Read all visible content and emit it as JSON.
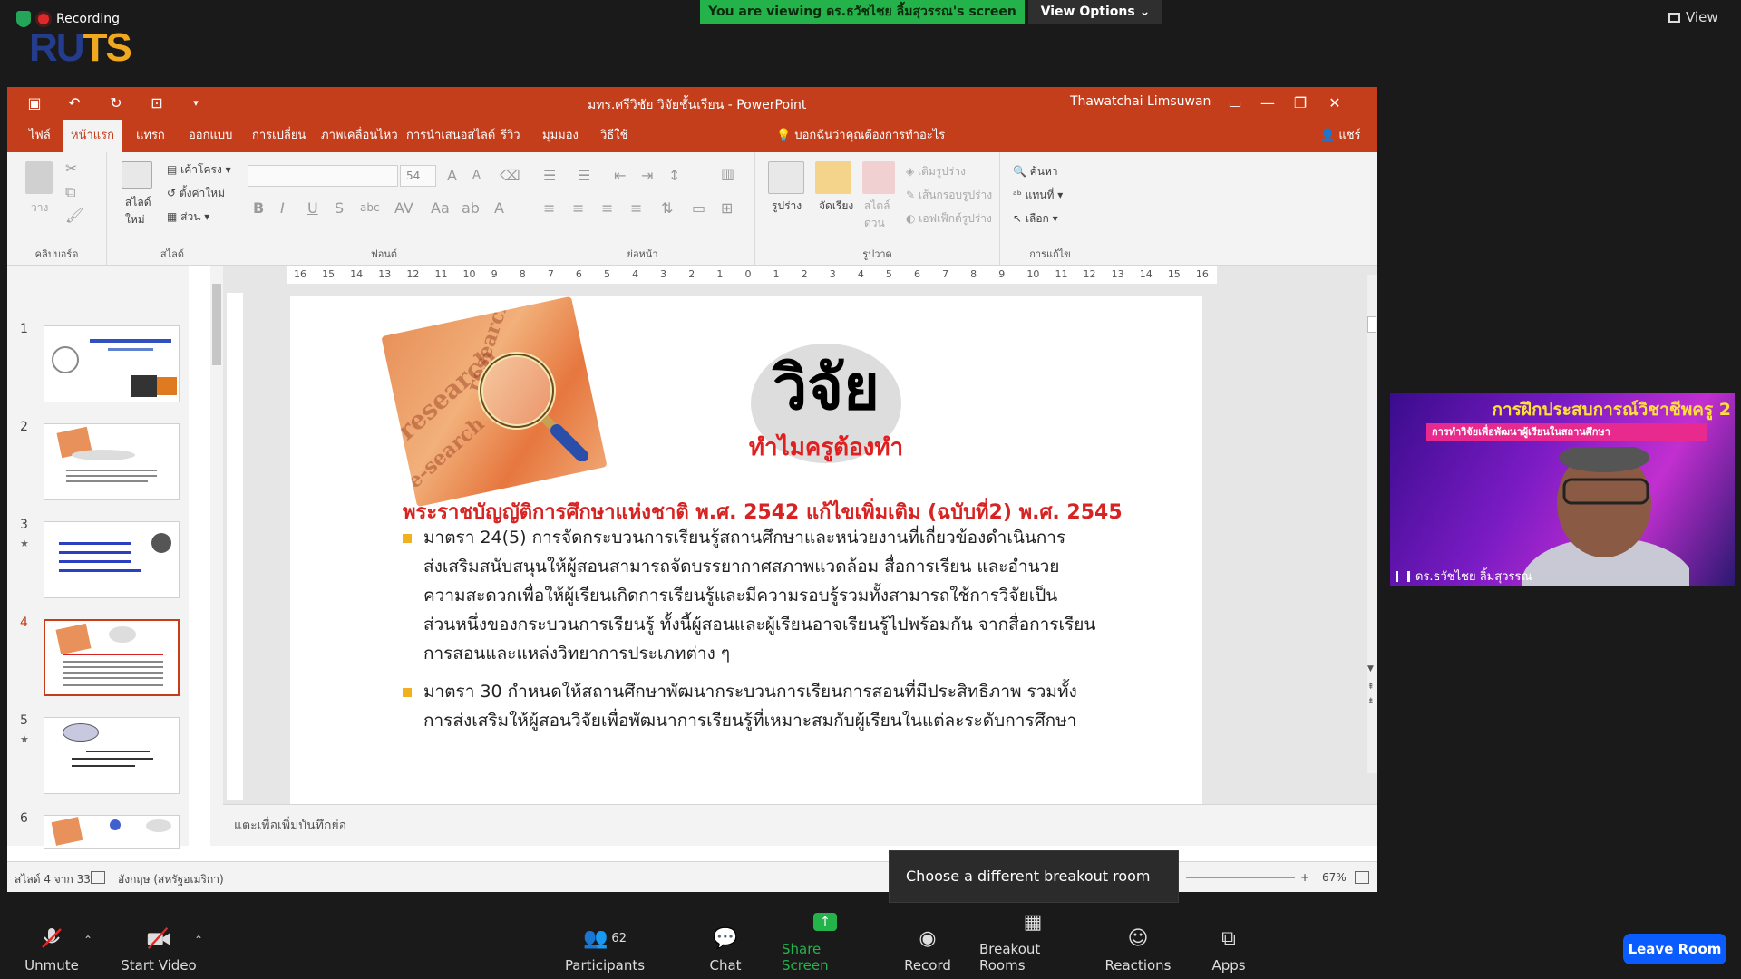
{
  "zoom": {
    "recording_label": "Recording",
    "viewing_banner": "You are viewing ดร.ธวัชไชย ลิ้มสุวรรณ's screen",
    "view_options": "View Options",
    "view_label": "View",
    "logo_text": "RUTS",
    "tooltip": "Choose a different breakout room",
    "toolbar": {
      "unmute": "Unmute",
      "start_video": "Start Video",
      "participants": "Participants",
      "participants_count": "62",
      "chat": "Chat",
      "share_screen": "Share Screen",
      "record": "Record",
      "breakout_rooms": "Breakout Rooms",
      "reactions": "Reactions",
      "apps": "Apps",
      "leave": "Leave Room"
    },
    "accent_green": "#24b24a",
    "leave_color": "#0b5cff"
  },
  "ppt": {
    "doc_title": "มทร.ศรีวิชัย วิจัยชั้นเรียน  -  PowerPoint",
    "user_name": "Thawatchai Limsuwan",
    "tabs": [
      "ไฟล์",
      "หน้าแรก",
      "แทรก",
      "ออกแบบ",
      "การเปลี่ยน",
      "ภาพเคลื่อนไหว",
      "การนำเสนอสไลด์",
      "รีวิว",
      "มุมมอง",
      "วิธีใช้"
    ],
    "tell_me": "บอกฉันว่าคุณต้องการทำอะไร",
    "share": "แชร์",
    "ribbon": {
      "clipboard": "คลิปบอร์ด",
      "paste": "วาง",
      "slides": "สไลด์",
      "new_slide": "สไลด์ใหม่",
      "layout": "เค้าโครง",
      "reset": "ตั้งค่าใหม่",
      "section": "ส่วน",
      "font": "ฟอนต์",
      "font_size": "54",
      "paragraph": "ย่อหน้า",
      "drawing": "รูปวาด",
      "shapes": "รูปร่าง",
      "arrange": "จัดเรียง",
      "quick_styles": "สไตล์ด่วน",
      "shape_fill": "เติมรูปร่าง",
      "shape_outline": "เส้นกรอบรูปร่าง",
      "shape_effects": "เอฟเฟ็กต์รูปร่าง",
      "editing": "การแก้ไข",
      "find": "ค้นหา",
      "replace": "แทนที่",
      "select": "เลือก"
    },
    "accent": "#c43e1c",
    "slide_numbers": [
      "1",
      "2",
      "3",
      "4",
      "5",
      "6"
    ],
    "notes_placeholder": "แตะเพื่อเพิ่มบันทึกย่อ",
    "status": {
      "slide_of": "สไลด์ 4 จาก 33",
      "language": "อังกฤษ (สหรัฐอเมริกา)",
      "zoom": "67%"
    },
    "ruler_ticks": [
      "16",
      "15",
      "14",
      "13",
      "12",
      "11",
      "10",
      "9",
      "8",
      "7",
      "6",
      "5",
      "4",
      "3",
      "2",
      "1",
      "0",
      "1",
      "2",
      "3",
      "4",
      "5",
      "6",
      "7",
      "8",
      "9",
      "10",
      "11",
      "12",
      "13",
      "14",
      "15",
      "16"
    ]
  },
  "slide": {
    "title": "วิจัย",
    "subtitle": "ทำไมครูต้องทำ",
    "act_title": "พระราชบัญญัติการศึกษาแห่งชาติ พ.ศ. 2542 แก้ไขเพิ่มเติม (ฉบับที่2) พ.ศ. 2545",
    "bullet1_lines": [
      "มาตรา 24(5) การจัดกระบวนการเรียนรู้สถานศึกษาและหน่วยงานที่เกี่ยวข้องดำเนินการ",
      "ส่งเสริมสนับสนุนให้ผู้สอนสามารถจัดบรรยากาศสภาพแวดล้อม สื่อการเรียน และอำนวย",
      "ความสะดวกเพื่อให้ผู้เรียนเกิดการเรียนรู้และมีความรอบรู้รวมทั้งสามารถใช้การวิจัยเป็น",
      "ส่วนหนึ่งของกระบวนการเรียนรู้ ทั้งนี้ผู้สอนและผู้เรียนอาจเรียนรู้ไปพร้อมกัน จากสื่อการเรียน",
      "การสอนและแหล่งวิทยาการประเภทต่าง ๆ"
    ],
    "bullet2_lines": [
      "มาตรา 30  กำหนดให้สถานศึกษาพัฒนากระบวนการเรียนการสอนที่มีประสิทธิภาพ รวมทั้ง",
      "การส่งเสริมให้ผู้สอนวิจัยเพื่อพัฒนาการเรียนรู้ที่เหมาะสมกับผู้เรียนในแต่ละระดับการศึกษา"
    ],
    "title_color": "#e02020"
  },
  "camera": {
    "banner": "การฝึกประสบการณ์วิชาชีพครู 2",
    "banner_sub": "การทำวิจัยเพื่อพัฒนาผู้เรียนในสถานศึกษา",
    "name": "ดร.ธวัชไชย ลิ้มสุวรรณ"
  }
}
